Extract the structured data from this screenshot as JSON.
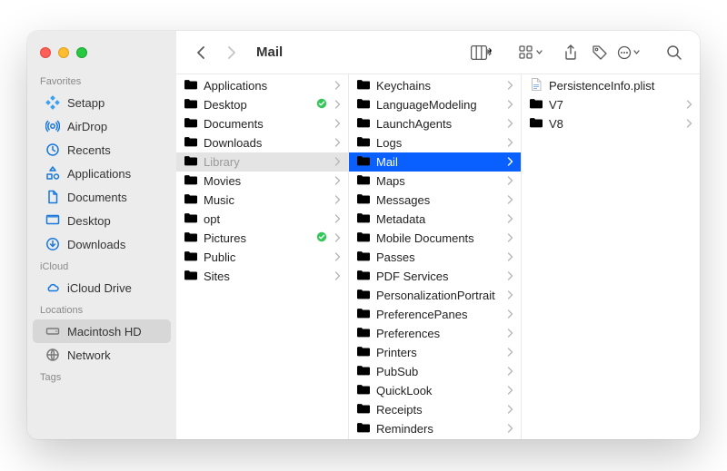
{
  "title": "Mail",
  "sidebar": {
    "groups": [
      {
        "label": "Favorites",
        "items": [
          {
            "label": "Setapp",
            "icon": "setapp"
          },
          {
            "label": "AirDrop",
            "icon": "airdrop"
          },
          {
            "label": "Recents",
            "icon": "clock"
          },
          {
            "label": "Applications",
            "icon": "apps"
          },
          {
            "label": "Documents",
            "icon": "doc"
          },
          {
            "label": "Desktop",
            "icon": "desktop"
          },
          {
            "label": "Downloads",
            "icon": "download"
          }
        ]
      },
      {
        "label": "iCloud",
        "items": [
          {
            "label": "iCloud Drive",
            "icon": "cloud"
          }
        ]
      },
      {
        "label": "Locations",
        "items": [
          {
            "label": "Macintosh HD",
            "icon": "hdd",
            "selected": true,
            "dim": true
          },
          {
            "label": "Network",
            "icon": "globe",
            "dim": true
          }
        ]
      },
      {
        "label": "Tags",
        "items": []
      }
    ]
  },
  "columns": [
    {
      "items": [
        {
          "label": "Applications"
        },
        {
          "label": "Desktop",
          "badge": true
        },
        {
          "label": "Documents"
        },
        {
          "label": "Downloads"
        },
        {
          "label": "Library",
          "selected": "inactive",
          "dim": true
        },
        {
          "label": "Movies"
        },
        {
          "label": "Music"
        },
        {
          "label": "opt"
        },
        {
          "label": "Pictures",
          "badge": true
        },
        {
          "label": "Public"
        },
        {
          "label": "Sites"
        }
      ]
    },
    {
      "scrollTop": 1,
      "items": [
        {
          "label": "Keychains"
        },
        {
          "label": "LanguageModeling"
        },
        {
          "label": "LaunchAgents"
        },
        {
          "label": "Logs"
        },
        {
          "label": "Mail",
          "selected": "active"
        },
        {
          "label": "Maps"
        },
        {
          "label": "Messages"
        },
        {
          "label": "Metadata"
        },
        {
          "label": "Mobile Documents"
        },
        {
          "label": "Passes"
        },
        {
          "label": "PDF Services"
        },
        {
          "label": "PersonalizationPortrait"
        },
        {
          "label": "PreferencePanes"
        },
        {
          "label": "Preferences"
        },
        {
          "label": "Printers"
        },
        {
          "label": "PubSub"
        },
        {
          "label": "QuickLook"
        },
        {
          "label": "Receipts"
        },
        {
          "label": "Reminders"
        }
      ]
    },
    {
      "items": [
        {
          "label": "PersistenceInfo.plist",
          "type": "file"
        },
        {
          "label": "V7"
        },
        {
          "label": "V8"
        }
      ]
    }
  ]
}
